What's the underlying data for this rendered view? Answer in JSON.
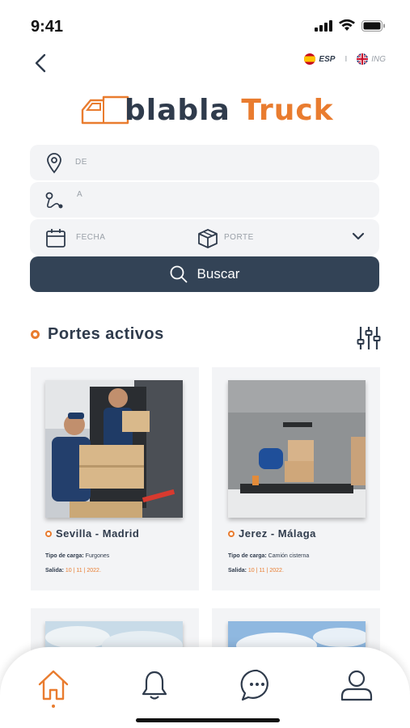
{
  "status": {
    "time": "9:41"
  },
  "language": {
    "esp": "ESP",
    "ing": "ING",
    "separator": "I"
  },
  "brand": {
    "part1": "blabla ",
    "part2": "Truck"
  },
  "search": {
    "from_label": "DE",
    "to_label": "A",
    "date_label": "FECHA",
    "cargo_label": "PORTE",
    "button_label": "Buscar"
  },
  "section": {
    "title": "Portes activos"
  },
  "cards": [
    {
      "title": "Sevilla - Madrid",
      "cargo_label": "Tipo de carga:",
      "cargo_value": "Furgones",
      "date_label": "Salida:",
      "date_value": "10 | 11 | 2022."
    },
    {
      "title": "Jerez - Málaga",
      "cargo_label": "Tipo de carga:",
      "cargo_value": "Camión cisterna",
      "date_label": "Salida:",
      "date_value": "10 | 11 | 2022."
    }
  ],
  "tabs": [
    "home-icon",
    "bell-icon",
    "chat-icon",
    "profile-icon"
  ],
  "colors": {
    "accent": "#e97c2f",
    "primary": "#334356",
    "field_bg": "#f3f4f6"
  }
}
